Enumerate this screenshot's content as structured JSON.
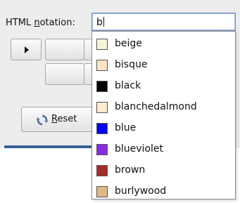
{
  "form": {
    "label_pre": "HTML ",
    "label_mnemonic": "n",
    "label_post": "otation:",
    "input_value": "b"
  },
  "buttons": {
    "reset_mnemonic": "R",
    "reset_rest": "eset",
    "reset_icon": "refresh-icon",
    "arrow_icon": "play-arrow-icon"
  },
  "completion": {
    "items": [
      {
        "name": "beige",
        "color": "#f5f5dc"
      },
      {
        "name": "bisque",
        "color": "#ffe4c4"
      },
      {
        "name": "black",
        "color": "#000000"
      },
      {
        "name": "blanchedalmond",
        "color": "#ffebcd"
      },
      {
        "name": "blue",
        "color": "#0000ff"
      },
      {
        "name": "blueviolet",
        "color": "#8a2be2"
      },
      {
        "name": "brown",
        "color": "#a52a2a"
      },
      {
        "name": "burlywood",
        "color": "#deb887"
      }
    ]
  },
  "colors": {
    "accent": "#3a5f92",
    "dialog_bg": "#ededed"
  }
}
